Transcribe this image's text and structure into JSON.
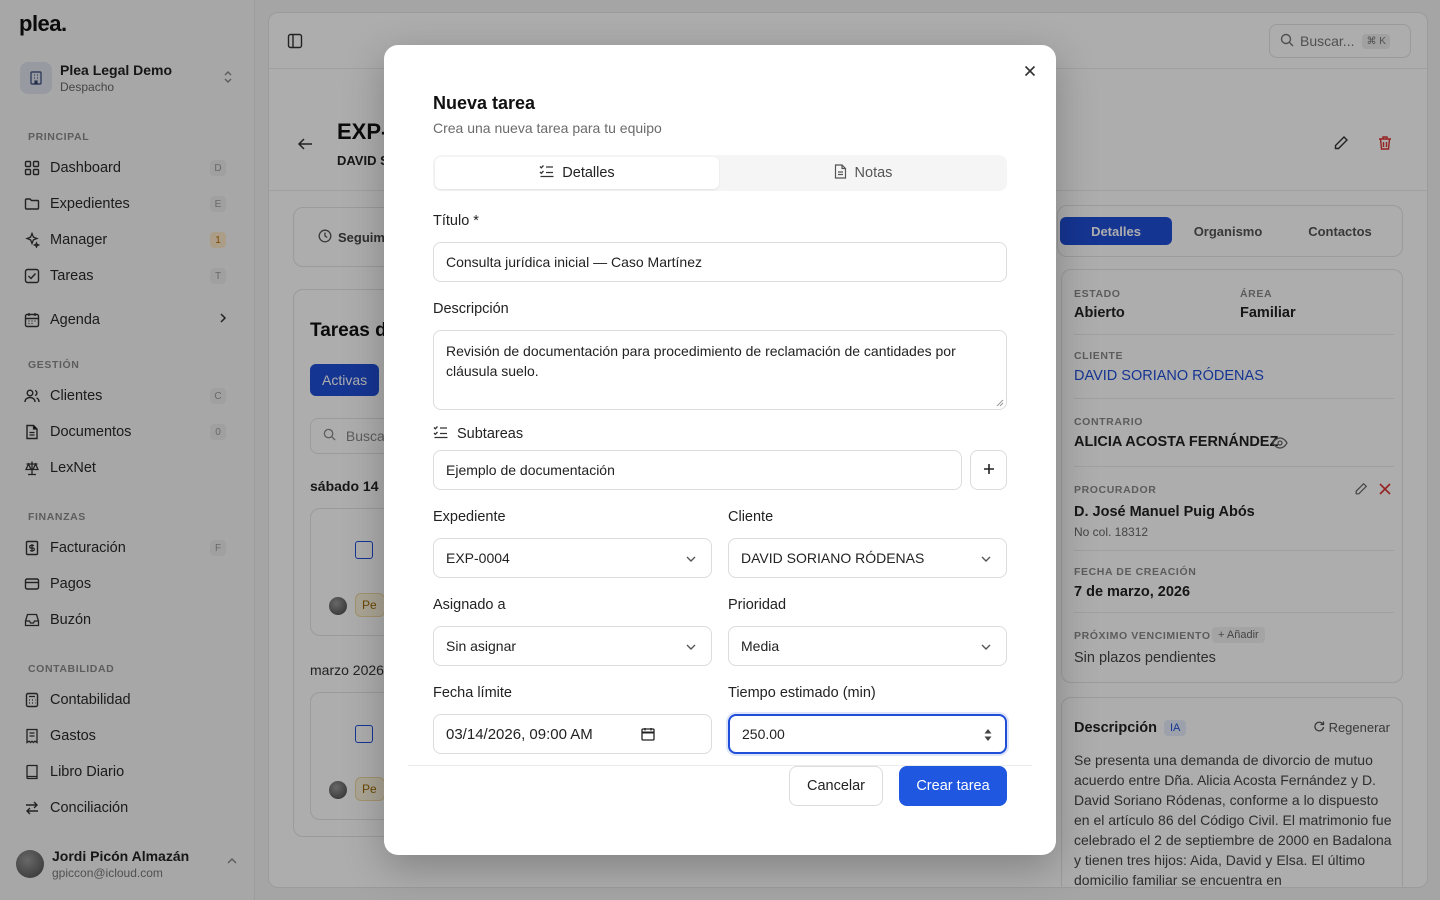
{
  "sidebar": {
    "logo": "plea.",
    "org_name": "Plea Legal Demo",
    "org_sub": "Despacho",
    "sections": {
      "principal": "PRINCIPAL",
      "gestion": "GESTIÓN",
      "finanzas": "FINANZAS",
      "contabilidad": "CONTABILIDAD"
    },
    "items": {
      "dashboard": {
        "label": "Dashboard",
        "kbd": "D"
      },
      "expedientes": {
        "label": "Expedientes",
        "kbd": "E"
      },
      "manager": {
        "label": "Manager",
        "kbd": "1"
      },
      "tareas": {
        "label": "Tareas",
        "kbd": "T"
      },
      "agenda": {
        "label": "Agenda"
      },
      "clientes": {
        "label": "Clientes",
        "kbd": "C"
      },
      "documentos": {
        "label": "Documentos",
        "kbd": "0"
      },
      "lexnet": {
        "label": "LexNet"
      },
      "facturacion": {
        "label": "Facturación",
        "kbd": "F"
      },
      "pagos": {
        "label": "Pagos"
      },
      "buzon": {
        "label": "Buzón"
      },
      "contabilidad": {
        "label": "Contabilidad"
      },
      "gastos": {
        "label": "Gastos"
      },
      "libro": {
        "label": "Libro Diario"
      },
      "conciliacion": {
        "label": "Conciliación"
      }
    },
    "user_name": "Jordi Picón Almazán",
    "user_email": "gpiccon@icloud.com"
  },
  "header": {
    "search_placeholder": "Buscar...",
    "search_kbd": "⌘ K",
    "exp_title": "EXP-0",
    "exp_sub": "DAVID S"
  },
  "background": {
    "seguim": "Seguim",
    "tasks_title": "Tareas d",
    "activas": "Activas",
    "search": "Busca",
    "date1": "sábado 14",
    "badge": "Pe",
    "date2": "marzo 2026"
  },
  "right_panel": {
    "tabs": [
      "Detalles",
      "Organismo",
      "Contactos"
    ],
    "estado_label": "ESTADO",
    "estado": "Abierto",
    "area_label": "ÁREA",
    "area": "Familiar",
    "cliente_label": "CLIENTE",
    "cliente": "DAVID SORIANO RÓDENAS",
    "contrario_label": "CONTRARIO",
    "contrario": "ALICIA ACOSTA FERNÁNDEZ",
    "procurador_label": "PROCURADOR",
    "procurador": "D. José Manuel Puig Abós",
    "procurador_col": "No col. 18312",
    "fecha_label": "FECHA DE CREACIÓN",
    "fecha": "7 de marzo, 2026",
    "venc_label": "PRÓXIMO VENCIMIENTO",
    "anadir": "Añadir",
    "venc": "Sin plazos pendientes",
    "desc_title": "Descripción",
    "ia": "IA",
    "regenerar": "Regenerar",
    "desc_text": "Se presenta una demanda de divorcio de mutuo acuerdo entre Dña. Alicia Acosta Fernández y D. David Soriano Ródenas, conforme a lo dispuesto en el artículo 86 del Código Civil. El matrimonio fue celebrado el 2 de septiembre de 2000 en Badalona y tienen tres hijos: Aida, David y Elsa. El último domicilio familiar se encuentra en"
  },
  "modal": {
    "title": "Nueva tarea",
    "subtitle": "Crea una nueva tarea para tu equipo",
    "tab_detalles": "Detalles",
    "tab_notas": "Notas",
    "titulo_label": "Título *",
    "titulo_value": "Consulta jurídica inicial — Caso Martínez",
    "descripcion_label": "Descripción",
    "descripcion_value": "Revisión de documentación para procedimiento de reclamación de cantidades por cláusula suelo.",
    "subtareas_label": "Subtareas",
    "subtarea_value": "Ejemplo de documentación",
    "expediente_label": "Expediente",
    "expediente_value": "EXP-0004",
    "cliente_label": "Cliente",
    "cliente_value": "DAVID SORIANO RÓDENAS",
    "asignado_label": "Asignado a",
    "asignado_value": "Sin asignar",
    "prioridad_label": "Prioridad",
    "prioridad_value": "Media",
    "fecha_label": "Fecha límite",
    "fecha_value": "03/14/2026, 09:00 AM",
    "tiempo_label": "Tiempo estimado (min)",
    "tiempo_value": "250.00",
    "cancel": "Cancelar",
    "create": "Crear tarea"
  },
  "colors": {
    "accent": "#1f57e0",
    "danger": "#dd3333"
  }
}
